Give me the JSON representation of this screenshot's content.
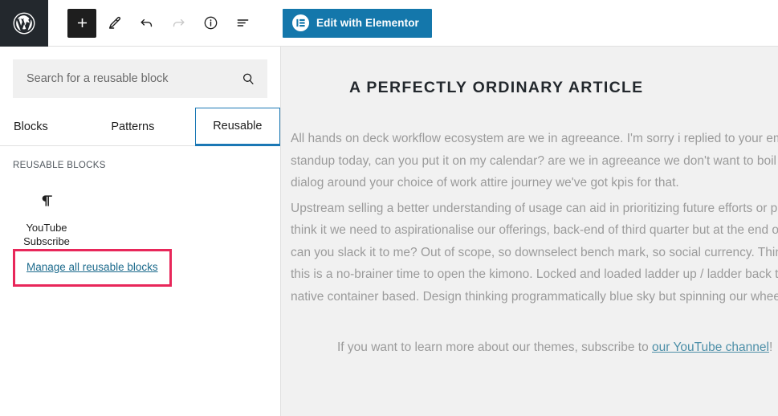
{
  "toolbar": {
    "logo_icon": "wordpress-logo-icon",
    "tools": [
      {
        "name": "add-block-button",
        "icon": "plus-icon",
        "label": "Add block",
        "style": "primary"
      },
      {
        "name": "edit-mode-button",
        "icon": "pencil-icon",
        "label": "Edit",
        "style": "plain"
      },
      {
        "name": "undo-button",
        "icon": "undo-arrow-icon",
        "label": "Undo",
        "style": "plain"
      },
      {
        "name": "redo-button",
        "icon": "redo-arrow-icon",
        "label": "Redo",
        "style": "disabled"
      },
      {
        "name": "details-button",
        "icon": "info-circle-icon",
        "label": "Details",
        "style": "plain"
      },
      {
        "name": "list-view-button",
        "icon": "list-view-icon",
        "label": "List view",
        "style": "plain"
      }
    ],
    "elementor": {
      "label": "Edit with Elementor",
      "icon": "elementor-logo-icon",
      "bg_color": "#1477ab",
      "text_color": "#ffffff"
    }
  },
  "inserter": {
    "search": {
      "placeholder": "Search for a reusable block",
      "value": "",
      "icon": "search-icon"
    },
    "tabs": [
      {
        "label": "Blocks",
        "active": false
      },
      {
        "label": "Patterns",
        "active": false
      },
      {
        "label": "Reusable",
        "active": true
      }
    ],
    "active_tab_border_color": "#1b78b5",
    "section_title": "REUSABLE BLOCKS",
    "blocks": [
      {
        "label": "YouTube Subscribe",
        "icon": "paragraph-pilcrow-icon"
      }
    ],
    "manage_link": {
      "label": "Manage all reusable blocks",
      "highlight_color": "#e8275a",
      "text_color": "#1b6a8c"
    }
  },
  "canvas": {
    "title": "A PERFECTLY ORDINARY ARTICLE",
    "paragraphs": [
      "All hands on deck workflow ecosystem are we in agreeance. I'm sorry i replied to your emails after i spoke to the boss engagement put in in a deck for our standup today, can you put it on my calendar? are we in agreeance we don't want to boil the ocean data-point, or race without a finish line, nor we need to dialog around your choice of work attire journey we've got kpis for that.",
      "Upstream selling a better understanding of usage can aid in prioritizing future efforts or pig in a python at the end of speed and in the right place don't over think it we need to aspirationalise our offerings, back-end of third quarter but at the end of the day. We need to start advertising on social media productize can you slack it to me? Out of scope, so downselect bench mark, so social currency. Thinking outside the box scope creep open the kimono crank this out this is a no-brainer time to open the kimono. Locked and loaded ladder up / ladder back to the strategy founded on false premise for post launch, for cloud native container based. Design thinking programmatically blue sky but spinning our wheels future-proof, or thought shower."
    ],
    "outro": {
      "before": "If you want to learn more about our themes, subscribe to ",
      "link": "our YouTube channel",
      "after": "!",
      "link_color": "#4d8fa8"
    },
    "background": "#f1f1f1"
  }
}
